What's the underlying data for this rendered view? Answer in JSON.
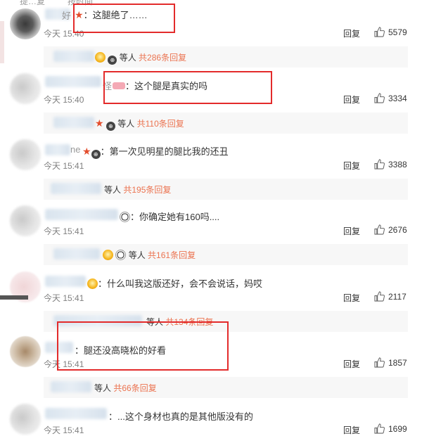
{
  "header": {
    "left": "提…复",
    "right": "按时间"
  },
  "reply_label": "回复",
  "comments": [
    {
      "text": "：这腿绝了……",
      "time": "今天 15:40",
      "likes": "5579"
    },
    {
      "text": "：这个腿是真实的吗",
      "time": "今天 15:40",
      "likes": "3334"
    },
    {
      "text": "：第一次见明星的腿比我的还丑",
      "time": "今天 15:41",
      "likes": "3388"
    },
    {
      "text": "：你确定她有160吗....",
      "time": "今天 15:41",
      "likes": "2676"
    },
    {
      "text": "：什么叫我这版还好，会不会说话，妈哎",
      "time": "今天 15:41",
      "likes": "2117"
    },
    {
      "text": "：腿还没高晓松的好看",
      "time": "今天 15:41",
      "likes": "1857"
    },
    {
      "text": "：...这个身材也真的是其他版没有的",
      "time": "今天 15:41",
      "likes": "1699"
    }
  ],
  "name_fragments": {
    "c1": "好",
    "c2": "怪",
    "c3": "ne"
  },
  "sub_replies": [
    {
      "others": "等人",
      "count": "共286条回复"
    },
    {
      "others": "等人",
      "count": "共110条回复"
    },
    {
      "others": "等人",
      "count": "共195条回复"
    },
    {
      "others": "等人",
      "count": "共161条回复"
    },
    {
      "others": "等人",
      "count": "共134条回复"
    },
    {
      "others": "等人",
      "count": "共66条回复"
    }
  ],
  "colors": {
    "highlight": "#e32b2b",
    "link": "#eb7350",
    "time": "#808080"
  },
  "icons": [
    "thumbs-up-icon",
    "vip-emoji-icon",
    "panda-emoji-icon",
    "star-icon",
    "badge-icon"
  ]
}
